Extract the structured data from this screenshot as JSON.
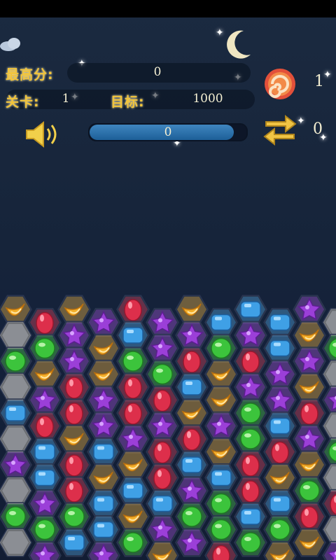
{
  "hud": {
    "best_score_label": "最高分:",
    "best_score_value": "0",
    "level_label": "关卡:",
    "level_value": "1",
    "target_label": "目标:",
    "target_value": "1000",
    "lollipop_count": "1",
    "swap_count": "0",
    "progress_value": "0",
    "progress_fraction": 0.92
  },
  "icons": {
    "sound": "speaker-icon",
    "lollipop": "lollipop-icon",
    "swap": "swap-arrows-icon",
    "moon": "crescent-moon-icon"
  },
  "colors": {
    "label_gold": "#f2c43a",
    "progress_blue": "#2f75b0"
  },
  "board": {
    "candy_legend": {
      "O": "orange-candy",
      "R": "red-candy",
      "P": "purple-star-candy",
      "B": "blue-candy",
      "G": "green-candy",
      "X": "blocked-cell"
    },
    "rows": [
      [
        "O",
        "R",
        "O",
        "P",
        "R",
        "P",
        "O",
        "B",
        "B",
        "B",
        "P",
        "X"
      ],
      [
        "X",
        "G",
        "P",
        "O",
        "B",
        "P",
        "P",
        "G",
        "P",
        "B",
        "O",
        "G"
      ],
      [
        "G",
        "O",
        "P",
        "O",
        "G",
        "G",
        "R",
        "O",
        "R",
        "P",
        "P",
        "X"
      ],
      [
        "X",
        "P",
        "R",
        "P",
        "R",
        "R",
        "B",
        "O",
        "P",
        "P",
        "O",
        "P"
      ],
      [
        "B",
        "R",
        "R",
        "P",
        "R",
        "P",
        "O",
        "P",
        "G",
        "B",
        "R",
        "X"
      ],
      [
        "X",
        "B",
        "O",
        "B",
        "P",
        "R",
        "R",
        "O",
        "G",
        "R",
        "P",
        "G"
      ],
      [
        "P",
        "B",
        "R",
        "O",
        "O",
        "R",
        "B",
        "B",
        "R",
        "O",
        "O",
        "X"
      ],
      [
        "X",
        "P",
        "R",
        "B",
        "B",
        "B",
        "P",
        "G",
        "R",
        "B",
        "G",
        "R"
      ],
      [
        "G",
        "G",
        "G",
        "B",
        "O",
        "P",
        "G",
        "G",
        "B",
        "G",
        "R",
        "X"
      ],
      [
        "X",
        "P",
        "B",
        "P",
        "G",
        "O",
        "P",
        "R",
        "G",
        "O",
        "O",
        "P"
      ]
    ]
  }
}
